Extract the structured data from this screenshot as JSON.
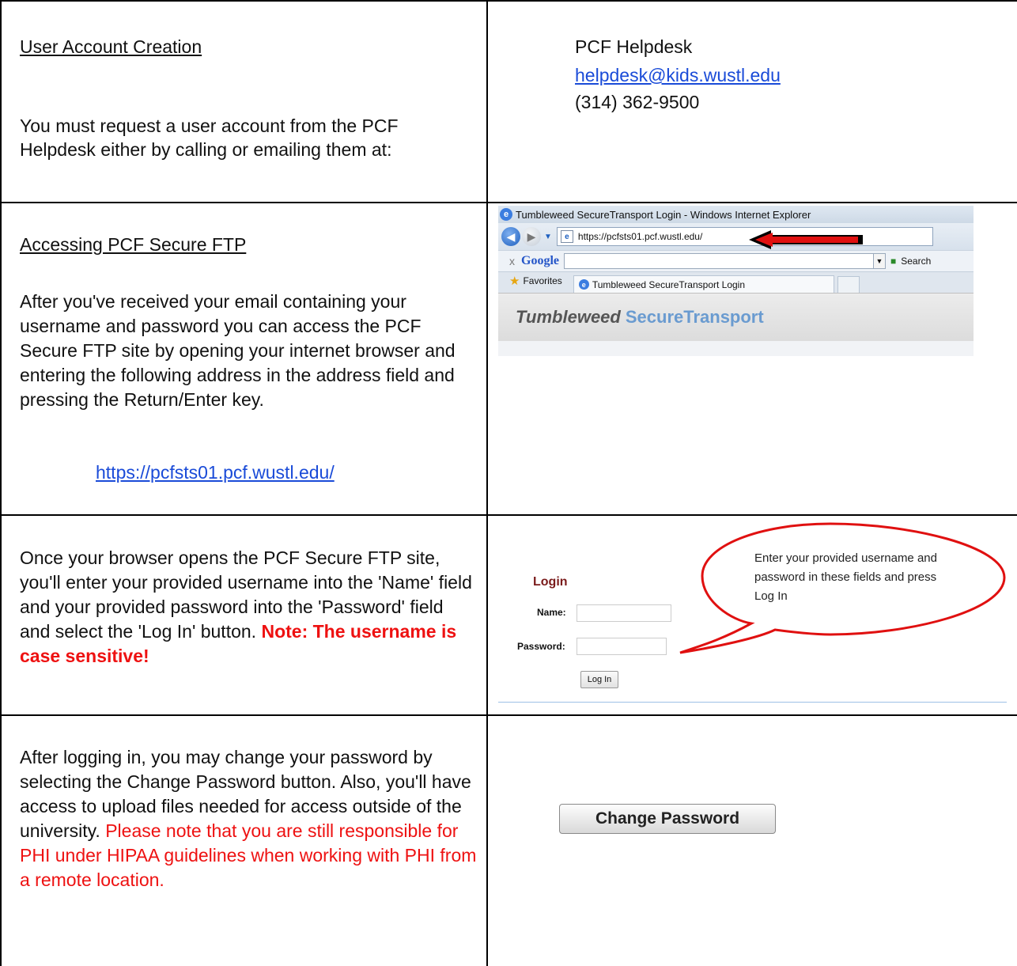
{
  "row1": {
    "heading": "User Account Creation",
    "body": "You must request a user account from the PCF Helpdesk either by calling or emailing them at:",
    "contact_name": "PCF Helpdesk",
    "contact_email": "helpdesk@kids.wustl.edu",
    "contact_phone": "(314) 362-9500"
  },
  "row2": {
    "heading": "Accessing PCF Secure FTP",
    "body": "After you've received your email containing your username and password you can access the PCF Secure FTP site by opening your internet browser and entering the following address in the address field and pressing the Return/Enter key.",
    "url": "https://pcfsts01.pcf.wustl.edu/",
    "browser": {
      "title": "Tumbleweed SecureTransport Login - Windows Internet Explorer",
      "address": "https://pcfsts01.pcf.wustl.edu/",
      "google_label": "Google",
      "search_label": "Search",
      "favorites_label": "Favorites",
      "tab_label": "Tumbleweed SecureTransport Login",
      "brand_part1": "Tumbleweed",
      "brand_part2": "SecureTransport"
    }
  },
  "row3": {
    "body": "Once your browser opens the PCF Secure FTP site, you'll enter your provided username into the 'Name' field and your provided password into the 'Password' field and select the 'Log In' button.",
    "note": "Note: The username is case sensitive!",
    "login": {
      "title": "Login",
      "name_label": "Name:",
      "password_label": "Password:",
      "button_label": "Log In",
      "callout": "Enter your provided username and password in these fields and press Log In"
    }
  },
  "row4": {
    "body": "After logging in, you may change your password by selecting the Change Password button. Also, you'll have access to upload files needed for access outside of the university.",
    "warning": "Please note that you are still responsible for PHI under HIPAA guidelines when working with PHI from a remote location.",
    "button_label": "Change Password"
  }
}
